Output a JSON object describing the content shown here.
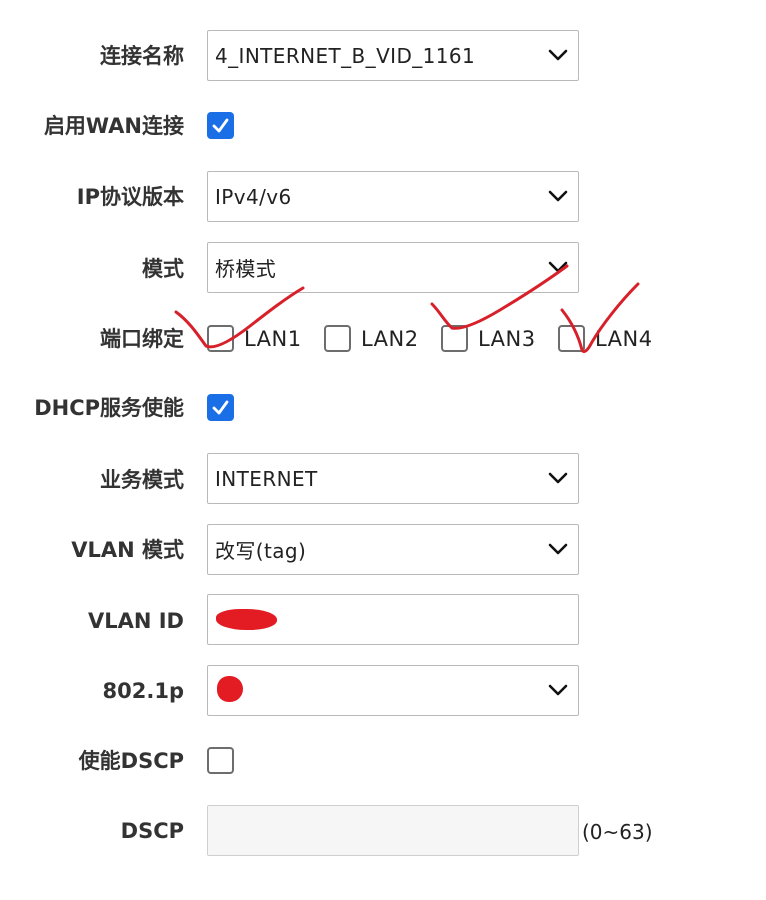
{
  "form": {
    "connection_name": {
      "label": "连接名称",
      "value": "4_INTERNET_B_VID_1161"
    },
    "enable_wan": {
      "label": "启用WAN连接",
      "checked": true
    },
    "ip_protocol": {
      "label": "IP协议版本",
      "value": "IPv4/v6"
    },
    "mode": {
      "label": "模式",
      "value": "桥模式"
    },
    "port_binding": {
      "label": "端口绑定",
      "ports": [
        {
          "label": "LAN1",
          "checked": false
        },
        {
          "label": "LAN2",
          "checked": false
        },
        {
          "label": "LAN3",
          "checked": false
        },
        {
          "label": "LAN4",
          "checked": false
        }
      ]
    },
    "dhcp_service": {
      "label": "DHCP服务使能",
      "checked": true
    },
    "service_mode": {
      "label": "业务模式",
      "value": "INTERNET"
    },
    "vlan_mode": {
      "label": "VLAN 模式",
      "value": "改写(tag)"
    },
    "vlan_id": {
      "label": "VLAN ID",
      "value": ""
    },
    "priority_8021p": {
      "label": "802.1p",
      "value": ""
    },
    "enable_dscp": {
      "label": "使能DSCP",
      "checked": false
    },
    "dscp": {
      "label": "DSCP",
      "value": "",
      "range_hint": "(0~63)"
    }
  },
  "colors": {
    "checkbox_checked": "#1a6fe6",
    "annotation": "#e31b23"
  }
}
